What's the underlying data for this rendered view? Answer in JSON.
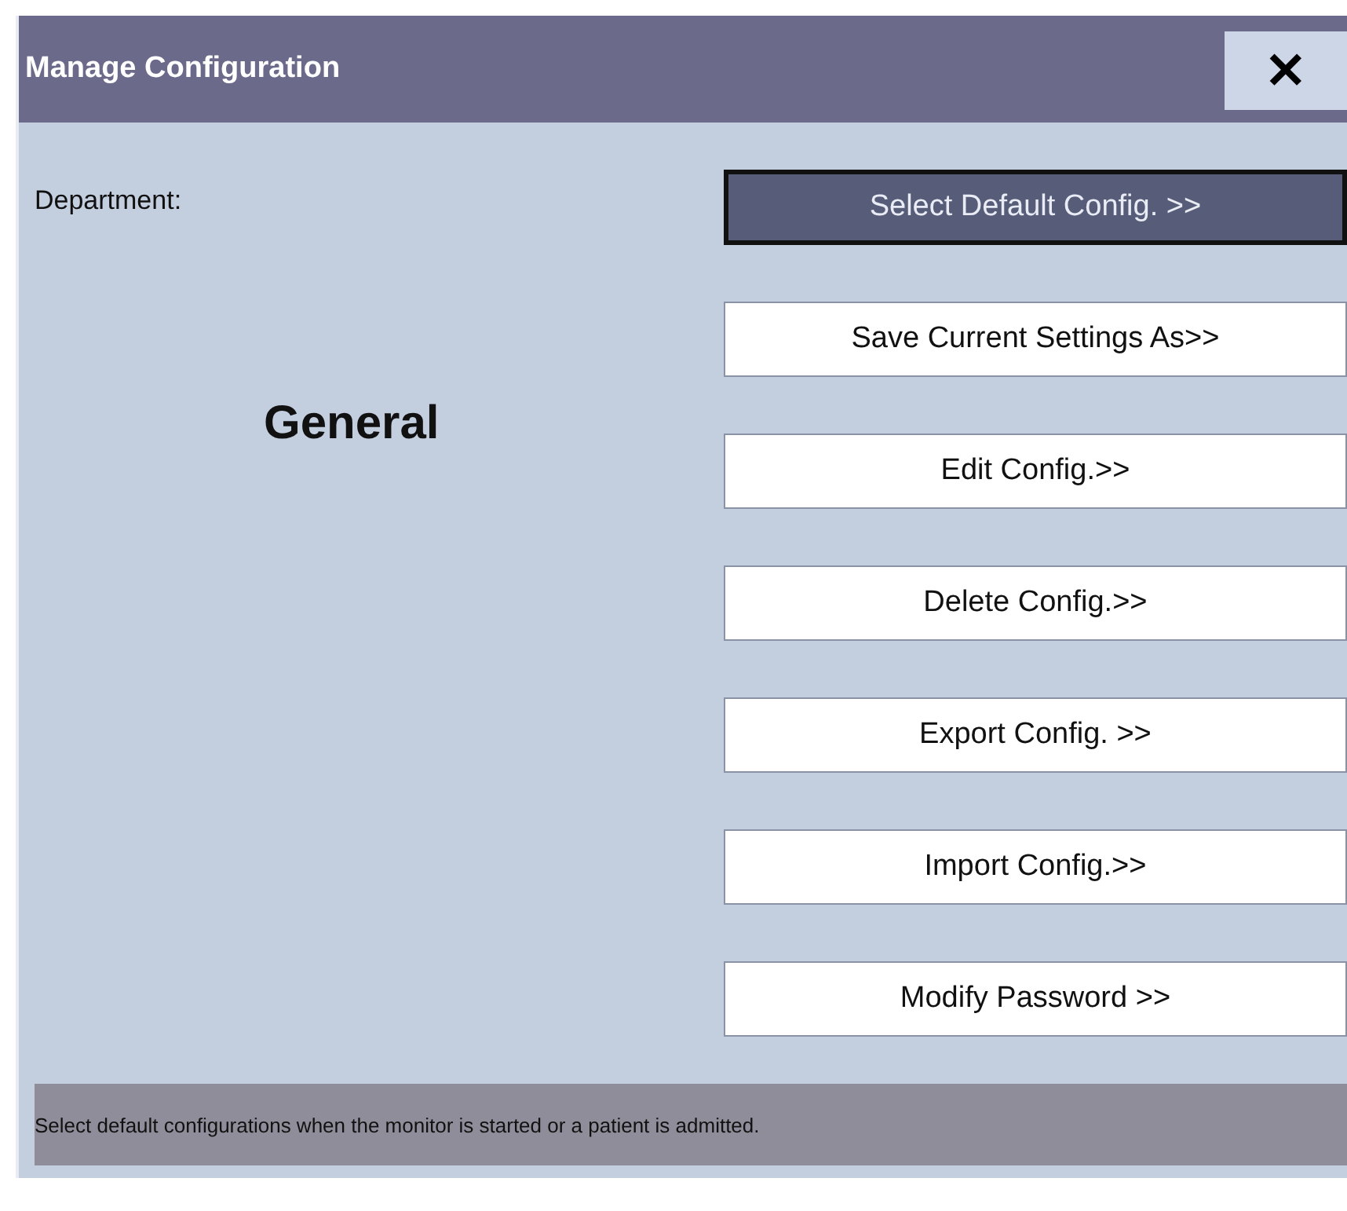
{
  "window": {
    "title": "Manage Configuration",
    "close": "✕"
  },
  "department": {
    "label": "Department:",
    "value": "General"
  },
  "buttons": [
    {
      "label": "Select Default Config. >>",
      "selected": true
    },
    {
      "label": "Save Current Settings As>>",
      "selected": false
    },
    {
      "label": "Edit Config.>>",
      "selected": false
    },
    {
      "label": "Delete Config.>>",
      "selected": false
    },
    {
      "label": "Export Config. >>",
      "selected": false
    },
    {
      "label": "Import Config.>>",
      "selected": false
    },
    {
      "label": "Modify Password >>",
      "selected": false
    }
  ],
  "status_bar": "Select default configurations when the monitor is started or a patient is admitted."
}
